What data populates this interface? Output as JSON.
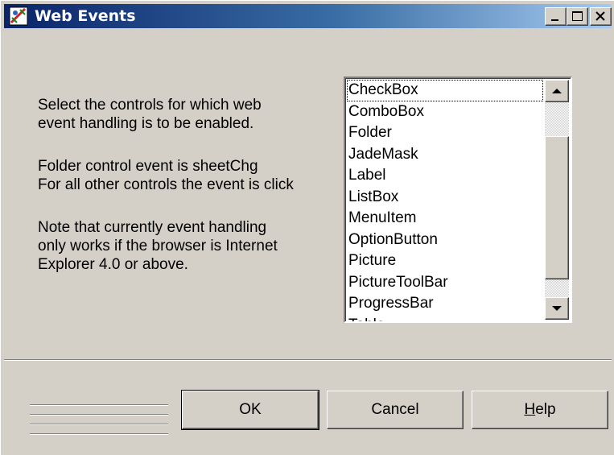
{
  "window": {
    "title": "Web Events",
    "icon": "web-events-app-icon",
    "controls": {
      "minimize": "minimize-icon",
      "maximize": "maximize-icon",
      "close": "close-icon"
    }
  },
  "description": {
    "line1": "Select the controls for which web",
    "line2": "event handling is to be enabled.",
    "line3": "Folder control event is sheetChg",
    "line4": "For all other controls the event is click",
    "line5": "Note that currently event handling",
    "line6": "only works if the browser is Internet",
    "line7": "Explorer 4.0 or above."
  },
  "controls_list": {
    "items": [
      "CheckBox",
      "ComboBox",
      "Folder",
      "JadeMask",
      "Label",
      "ListBox",
      "MenuItem",
      "OptionButton",
      "Picture",
      "PictureToolBar",
      "ProgressBar",
      "Table"
    ],
    "focused_index": 0
  },
  "buttons": {
    "ok_label": "OK",
    "cancel_label": "Cancel",
    "help_underlined": "H",
    "help_rest": "elp"
  },
  "colors": {
    "face": "#d4d0c8",
    "title_start": "#0a246a",
    "title_end": "#a6caf0"
  }
}
